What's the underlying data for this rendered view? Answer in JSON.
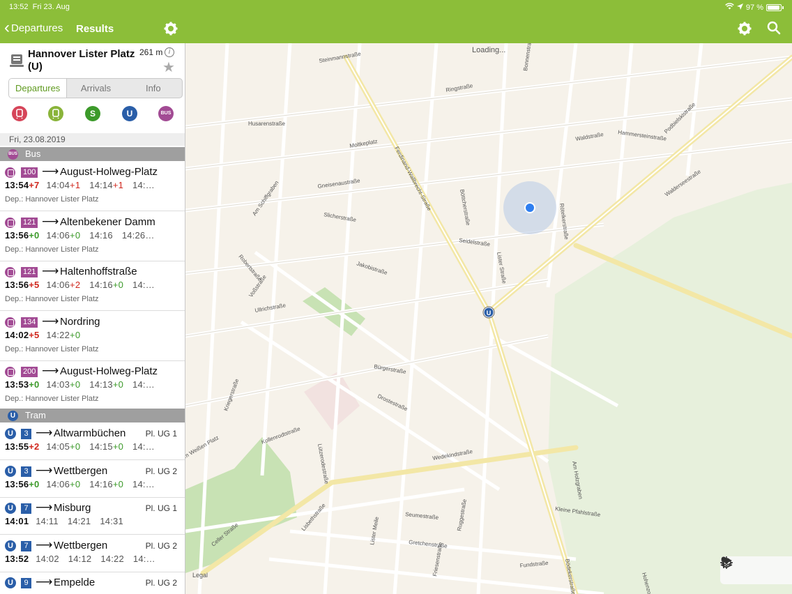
{
  "status": {
    "time": "13:52",
    "date": "Fri 23. Aug",
    "battery": "97 %"
  },
  "nav": {
    "back_label": "Departures",
    "title": "Results"
  },
  "stop": {
    "name": "Hannover Lister Platz (U)",
    "distance": "261 m"
  },
  "tabs": [
    {
      "label": "Departures"
    },
    {
      "label": "Arrivals"
    },
    {
      "label": "Info"
    }
  ],
  "modes": [
    {
      "name": "regional-train",
      "label": "",
      "color": "#d64559"
    },
    {
      "name": "tram",
      "label": "",
      "color": "#8ab43a"
    },
    {
      "name": "s-bahn",
      "label": "S",
      "color": "#3c9a2a"
    },
    {
      "name": "u-bahn",
      "label": "U",
      "color": "#2a5ea8"
    },
    {
      "name": "bus",
      "label": "BUS",
      "color": "#a24b94"
    }
  ],
  "date_label": "Fri, 23.08.2019",
  "sections": {
    "bus": {
      "label": "Bus",
      "badge": "BUS"
    },
    "tram": {
      "label": "Tram",
      "badge": "U"
    }
  },
  "bus_departures": [
    {
      "line": "100",
      "dest": "August-Holweg-Platz",
      "first_time": "13:54",
      "first_delay": "+7",
      "first_delay_color": "red",
      "times": [
        {
          "t": "14:04",
          "d": "+1",
          "c": "red"
        },
        {
          "t": "14:14",
          "d": "+1",
          "c": "red"
        },
        {
          "t": "14:…",
          "d": "",
          "c": ""
        }
      ],
      "from": "Dep.: Hannover Lister Platz"
    },
    {
      "line": "121",
      "dest": "Altenbekener Damm",
      "first_time": "13:56",
      "first_delay": "+0",
      "first_delay_color": "green",
      "times": [
        {
          "t": "14:06",
          "d": "+0",
          "c": "green"
        },
        {
          "t": "14:16",
          "d": "",
          "c": ""
        },
        {
          "t": "14:26…",
          "d": "",
          "c": ""
        }
      ],
      "from": "Dep.: Hannover Lister Platz"
    },
    {
      "line": "121",
      "dest": "Haltenhoffstraße",
      "first_time": "13:56",
      "first_delay": "+5",
      "first_delay_color": "red",
      "times": [
        {
          "t": "14:06",
          "d": "+2",
          "c": "red"
        },
        {
          "t": "14:16",
          "d": "+0",
          "c": "green"
        },
        {
          "t": "14:…",
          "d": "",
          "c": ""
        }
      ],
      "from": "Dep.: Hannover Lister Platz"
    },
    {
      "line": "134",
      "dest": "Nordring",
      "first_time": "14:02",
      "first_delay": "+5",
      "first_delay_color": "red",
      "times": [
        {
          "t": "14:22",
          "d": "+0",
          "c": "green"
        }
      ],
      "from": "Dep.: Hannover Lister Platz"
    },
    {
      "line": "200",
      "dest": "August-Holweg-Platz",
      "first_time": "13:53",
      "first_delay": "+0",
      "first_delay_color": "green",
      "times": [
        {
          "t": "14:03",
          "d": "+0",
          "c": "green"
        },
        {
          "t": "14:13",
          "d": "+0",
          "c": "green"
        },
        {
          "t": "14:…",
          "d": "",
          "c": ""
        }
      ],
      "from": "Dep.: Hannover Lister Platz"
    }
  ],
  "tram_departures": [
    {
      "line": "3",
      "dest": "Altwarmbüchen",
      "platform": "Pl. UG 1",
      "first_time": "13:55",
      "first_delay": "+2",
      "first_delay_color": "red",
      "times": [
        {
          "t": "14:05",
          "d": "+0",
          "c": "green"
        },
        {
          "t": "14:15",
          "d": "+0",
          "c": "green"
        },
        {
          "t": "14:…",
          "d": "",
          "c": ""
        }
      ]
    },
    {
      "line": "3",
      "dest": "Wettbergen",
      "platform": "Pl. UG 2",
      "first_time": "13:56",
      "first_delay": "+0",
      "first_delay_color": "green",
      "times": [
        {
          "t": "14:06",
          "d": "+0",
          "c": "green"
        },
        {
          "t": "14:16",
          "d": "+0",
          "c": "green"
        },
        {
          "t": "14:…",
          "d": "",
          "c": ""
        }
      ]
    },
    {
      "line": "7",
      "dest": "Misburg",
      "platform": "Pl. UG 1",
      "first_time": "14:01",
      "first_delay": "",
      "first_delay_color": "",
      "times": [
        {
          "t": "14:11",
          "d": "",
          "c": ""
        },
        {
          "t": "14:21",
          "d": "",
          "c": ""
        },
        {
          "t": "14:31",
          "d": "",
          "c": ""
        }
      ]
    },
    {
      "line": "7",
      "dest": "Wettbergen",
      "platform": "Pl. UG 2",
      "first_time": "13:52",
      "first_delay": "",
      "first_delay_color": "",
      "times": [
        {
          "t": "14:02",
          "d": "",
          "c": ""
        },
        {
          "t": "14:12",
          "d": "",
          "c": ""
        },
        {
          "t": "14:22",
          "d": "",
          "c": ""
        },
        {
          "t": "14:…",
          "d": "",
          "c": ""
        }
      ]
    },
    {
      "line": "9",
      "dest": "Empelde",
      "platform": "Pl. UG 2",
      "first_time": "",
      "first_delay": "",
      "first_delay_color": "",
      "times": []
    }
  ],
  "map": {
    "loading": "Loading...",
    "legal": "Legal",
    "streets": [
      "Steinmannstraße",
      "Husarenstraße",
      "Moltkeplatz",
      "Ferdinand-Wallbrecht-Straße",
      "Hammersteinstraße",
      "Podbielskistraße",
      "Waldstraße",
      "Walderseestraße",
      "Böttcherstraße",
      "Seidelstraße",
      "Lister Straße",
      "Gneisenaustraße",
      "Slicherstraße",
      "Am Schiffgraben",
      "Jakobistraße",
      "Robertstraße",
      "Voßstraße",
      "Ullrichstraße",
      "Bürgerstraße",
      "Drostestraße",
      "Kriegerstraße",
      "Kollenrodtstraße",
      "Lützerodestraße",
      "Wedekindstraße",
      "Am Weißen Platz",
      "Celler Straße",
      "Lisbethstraße",
      "Lister Meile",
      "Seumestraße",
      "Gretchenstraße",
      "Ruggestraße",
      "Fundstraße",
      "Bödekerstraße",
      "Kleine Pfahlstraße",
      "Hohenzollernstraße",
      "Am Holzgraben",
      "Bonnenstraße",
      "Ringstraße",
      "Friesenstraße",
      "Rötelkerstraße"
    ]
  },
  "colors": {
    "accent": "#8cbe39",
    "bus": "#a24b94",
    "ubahn": "#2a5ea8",
    "delay_red": "#d0281e",
    "delay_green": "#3c9a2a"
  }
}
